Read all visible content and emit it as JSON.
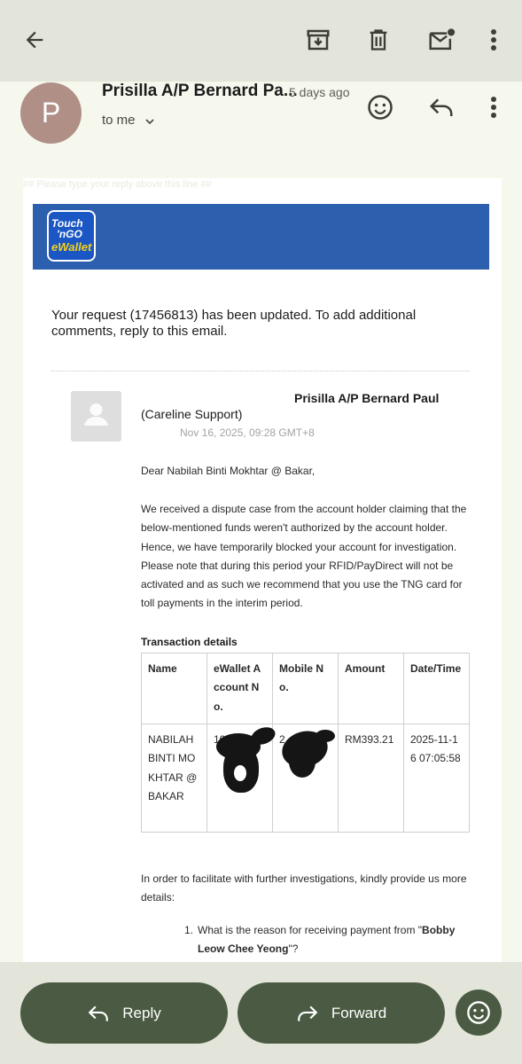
{
  "header": {
    "back_icon": "arrow-left-icon",
    "archive_icon": "archive-icon",
    "delete_icon": "trash-icon",
    "unread_icon": "mark-unread-icon",
    "more_icon": "more-vert-icon"
  },
  "sender": {
    "avatar_initial": "P",
    "avatar_color": "#b08f86",
    "name": "Prisilla A/P Bernard Pa...",
    "time": "5 days ago",
    "recipient": "to me"
  },
  "email": {
    "faint_notice": "## Please type your reply above this line ##",
    "logo": {
      "line1": "Touch",
      "line2": "'nGO",
      "line3": "eWallet"
    },
    "request_text": "Your request (17456813) has been updated. To add additional comments, reply to this email.",
    "agent_name": "Prisilla A/P Bernard Paul",
    "agent_team": "(Careline Support)",
    "agent_date": "Nov 16, 2025, 09:28 GMT+8",
    "greeting": "Dear Nabilah Binti Mokhtar @ Bakar,",
    "body": "We received a dispute case from the account holder claiming that the below-mentioned funds weren't authorized by the account holder. Hence, we have temporarily blocked your account for investigation. Please note that during this period your RFID/PayDirect will not be activated and as such we recommend that you use the TNG card for toll payments in the interim period.",
    "transaction_heading": "Transaction details",
    "table": {
      "headers": [
        "Name",
        "eWallet Account No.",
        "Mobile No.",
        "Amount",
        "Date/Time"
      ],
      "row": [
        "NABILAH BINTI MOKHTAR @ BAKAR",
        "10",
        "2",
        "RM393.21",
        "2025-11-16 07:05:58"
      ]
    },
    "follow_up": "In order to facilitate with further investigations, kindly provide us more details:",
    "question_number": "1.",
    "question_prefix": "What is the reason for receiving payment from \"",
    "question_name": "Bobby Leow Chee Yeong",
    "question_suffix": "\"?"
  },
  "actions": {
    "reply_label": "Reply",
    "forward_label": "Forward"
  },
  "colors": {
    "accent": "#4b5b43",
    "banner": "#2c5fad",
    "background": "#f6f8ee"
  }
}
